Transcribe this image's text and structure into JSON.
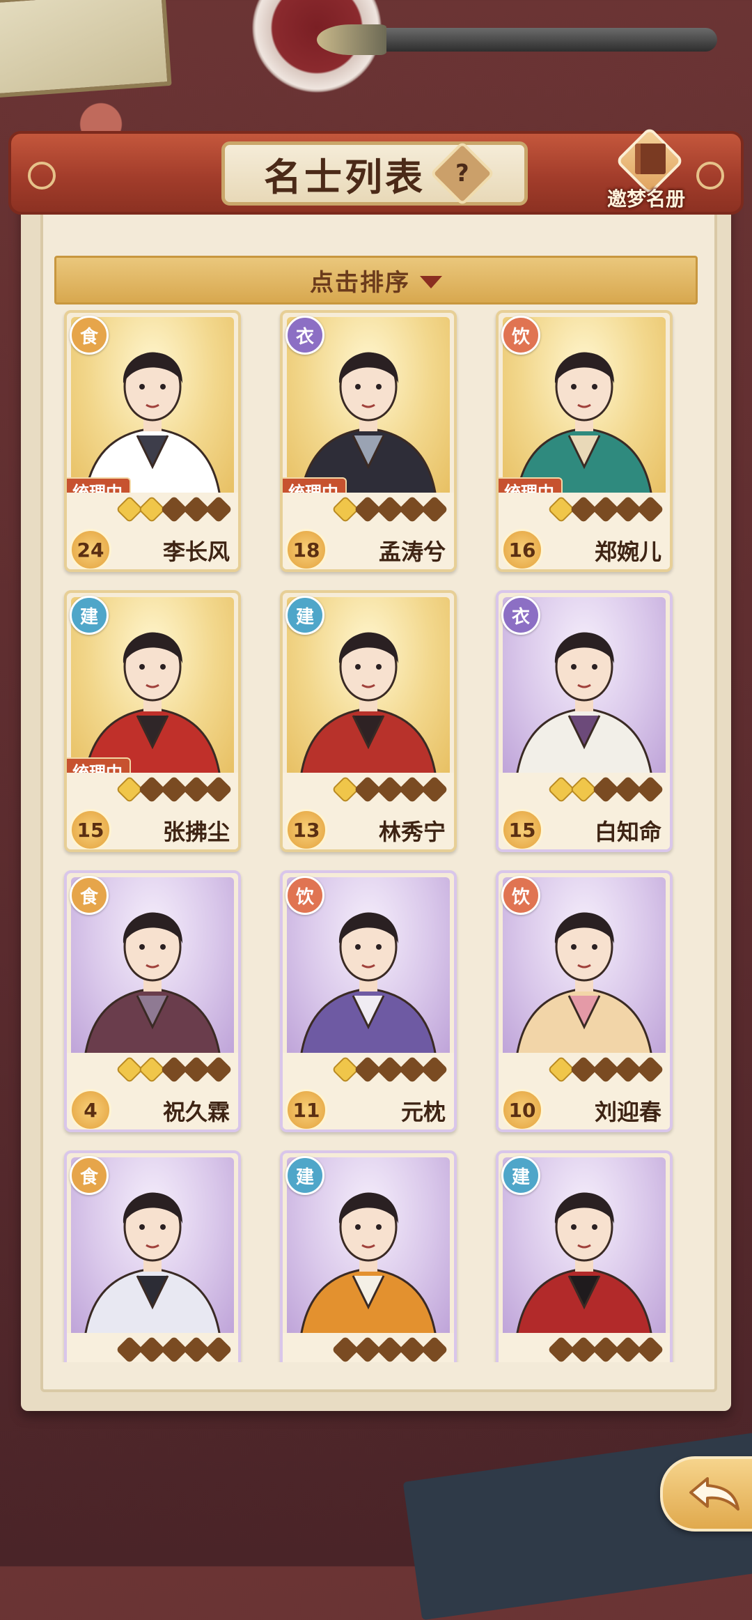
{
  "header": {
    "title": "名士列表",
    "help_icon": "?",
    "dream_book_label": "邀梦名册"
  },
  "sort": {
    "label": "点击排序"
  },
  "tags": {
    "managing": "统理中"
  },
  "cards": [
    {
      "category": "食",
      "category_type": "food",
      "name": "李长风",
      "level": "24",
      "stars": 2,
      "managing": true,
      "frame": "gold",
      "robe": "#ffffff",
      "accent": "#3d3d4a"
    },
    {
      "category": "衣",
      "category_type": "cloth",
      "name": "孟涛兮",
      "level": "18",
      "stars": 1,
      "managing": true,
      "frame": "gold",
      "robe": "#2e2d38",
      "accent": "#9aa3b3"
    },
    {
      "category": "饮",
      "category_type": "drink",
      "name": "郑婉儿",
      "level": "16",
      "stars": 1,
      "managing": true,
      "frame": "gold",
      "robe": "#2f8a7e",
      "accent": "#e9d9b8"
    },
    {
      "category": "建",
      "category_type": "build",
      "name": "张拂尘",
      "level": "15",
      "stars": 1,
      "managing": true,
      "frame": "gold",
      "robe": "#c0302a",
      "accent": "#2f2628"
    },
    {
      "category": "建",
      "category_type": "build",
      "name": "林秀宁",
      "level": "13",
      "stars": 1,
      "managing": false,
      "frame": "gold",
      "robe": "#b8322b",
      "accent": "#2e2224"
    },
    {
      "category": "衣",
      "category_type": "cloth",
      "name": "白知命",
      "level": "15",
      "stars": 2,
      "managing": false,
      "frame": "purple",
      "robe": "#f2efe8",
      "accent": "#6c4a7a"
    },
    {
      "category": "食",
      "category_type": "food",
      "name": "祝久霖",
      "level": "4",
      "stars": 2,
      "managing": false,
      "frame": "purple",
      "robe": "#6a3d4c",
      "accent": "#8f7a93"
    },
    {
      "category": "饮",
      "category_type": "drink",
      "name": "元枕",
      "level": "11",
      "stars": 1,
      "managing": false,
      "frame": "purple",
      "robe": "#6e5aa3",
      "accent": "#f0ecf3"
    },
    {
      "category": "饮",
      "category_type": "drink",
      "name": "刘迎春",
      "level": "10",
      "stars": 1,
      "managing": false,
      "frame": "purple",
      "robe": "#f2d5a8",
      "accent": "#e49aa7"
    },
    {
      "category": "食",
      "category_type": "food",
      "name": "",
      "level": "",
      "stars": 0,
      "managing": false,
      "frame": "purple",
      "robe": "#e8e8f2",
      "accent": "#2c2c35"
    },
    {
      "category": "建",
      "category_type": "build",
      "name": "",
      "level": "",
      "stars": 0,
      "managing": false,
      "frame": "purple",
      "robe": "#e3912f",
      "accent": "#f4f0e6"
    },
    {
      "category": "建",
      "category_type": "build",
      "name": "",
      "level": "",
      "stars": 0,
      "managing": false,
      "frame": "purple",
      "robe": "#b22a2a",
      "accent": "#1f1b1d"
    }
  ],
  "colors": {
    "header_red": "#a33d2b",
    "panel": "#f3ead8",
    "sort_bar": "#e2b764",
    "star_on": "#f0c64a",
    "star_off": "#7a4b22"
  },
  "icons": {
    "help": "question-icon",
    "dream_book": "book-icon",
    "back": "back-arrow-icon",
    "sort": "caret-down-icon"
  }
}
